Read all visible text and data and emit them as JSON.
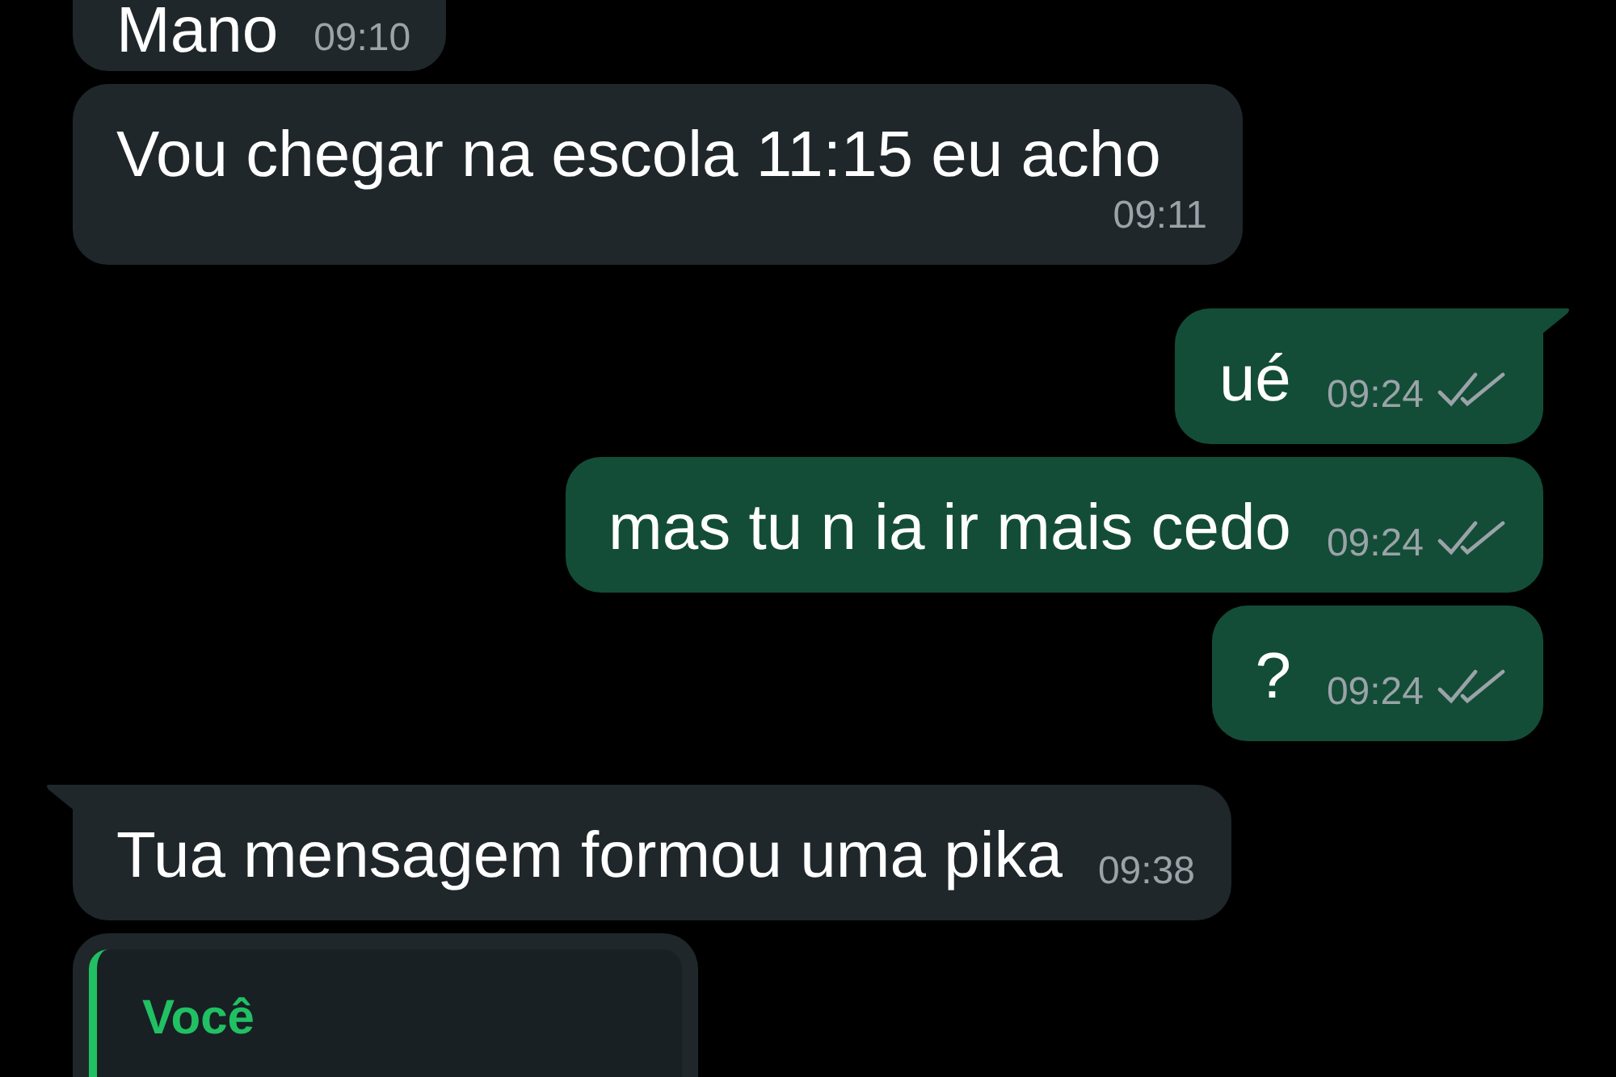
{
  "messages": [
    {
      "outgoing": false,
      "text": "Mano",
      "time": "09:10"
    },
    {
      "outgoing": false,
      "text": "Vou chegar na escola 11:15 eu acho",
      "time": "09:11"
    },
    {
      "outgoing": true,
      "text": "ué",
      "time": "09:24",
      "read": false
    },
    {
      "outgoing": true,
      "text": "mas tu n ia ir mais cedo",
      "time": "09:24",
      "read": false
    },
    {
      "outgoing": true,
      "text": "?",
      "time": "09:24",
      "read": false
    },
    {
      "outgoing": false,
      "text": "Tua mensagem formou uma pika",
      "time": "09:38"
    },
    {
      "outgoing": false,
      "quote": {
        "author": "Você"
      }
    }
  ]
}
